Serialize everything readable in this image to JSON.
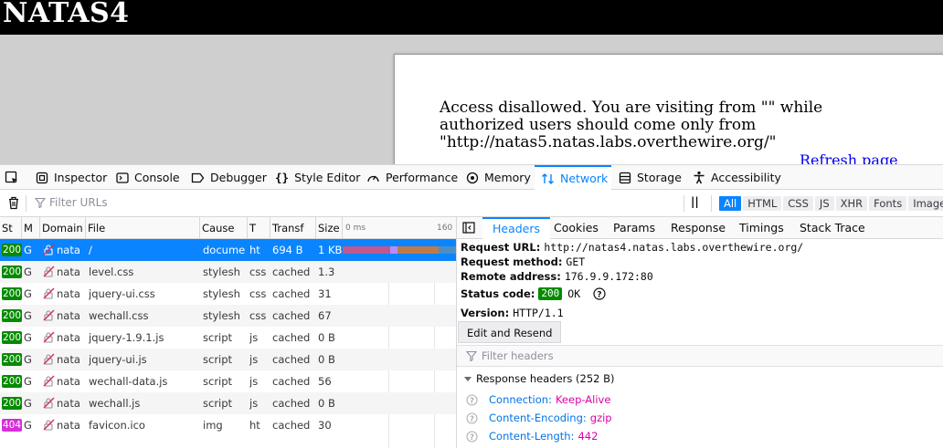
{
  "page": {
    "title": "NATAS4",
    "message": "Access disallowed. You are visiting from \"\" while authorized users should come only from \"http://natas5.natas.labs.overthewire.org/\"",
    "refresh_label": "Refresh page"
  },
  "devtools": {
    "tabs": [
      {
        "label": "Inspector",
        "icon": "inspector-icon"
      },
      {
        "label": "Console",
        "icon": "console-icon"
      },
      {
        "label": "Debugger",
        "icon": "debugger-icon"
      },
      {
        "label": "Style Editor",
        "icon": "style-editor-icon"
      },
      {
        "label": "Performance",
        "icon": "performance-icon"
      },
      {
        "label": "Memory",
        "icon": "memory-icon"
      },
      {
        "label": "Network",
        "icon": "network-icon",
        "active": true
      },
      {
        "label": "Storage",
        "icon": "storage-icon"
      },
      {
        "label": "Accessibility",
        "icon": "accessibility-icon"
      }
    ],
    "filter_placeholder": "Filter URLs",
    "pause_symbol": "||",
    "type_filters": [
      "All",
      "HTML",
      "CSS",
      "JS",
      "XHR",
      "Fonts",
      "Images"
    ],
    "active_type_filter": "All"
  },
  "requests": {
    "columns": [
      "St",
      "M",
      "Domain",
      "File",
      "Cause",
      "T",
      "Transf",
      "Size",
      "0 ms",
      "160"
    ],
    "rows": [
      {
        "status": "200",
        "method": "G",
        "domain": "nata",
        "file": "/",
        "cause": "docume",
        "type": "ht",
        "transferred": "694 B",
        "size": "1 KB",
        "selected": true
      },
      {
        "status": "200",
        "method": "G",
        "domain": "nata",
        "file": "level.css",
        "cause": "stylesh",
        "type": "css",
        "transferred": "cached",
        "size": "1.3"
      },
      {
        "status": "200",
        "method": "G",
        "domain": "nata",
        "file": "jquery-ui.css",
        "cause": "stylesh",
        "type": "css",
        "transferred": "cached",
        "size": "31"
      },
      {
        "status": "200",
        "method": "G",
        "domain": "nata",
        "file": "wechall.css",
        "cause": "stylesh",
        "type": "css",
        "transferred": "cached",
        "size": "67"
      },
      {
        "status": "200",
        "method": "G",
        "domain": "nata",
        "file": "jquery-1.9.1.js",
        "cause": "script",
        "type": "js",
        "transferred": "cached",
        "size": "0 B"
      },
      {
        "status": "200",
        "method": "G",
        "domain": "nata",
        "file": "jquery-ui.js",
        "cause": "script",
        "type": "js",
        "transferred": "cached",
        "size": "0 B"
      },
      {
        "status": "200",
        "method": "G",
        "domain": "nata",
        "file": "wechall-data.js",
        "cause": "script",
        "type": "js",
        "transferred": "cached",
        "size": "56"
      },
      {
        "status": "200",
        "method": "G",
        "domain": "nata",
        "file": "wechall.js",
        "cause": "script",
        "type": "js",
        "transferred": "cached",
        "size": "0 B"
      },
      {
        "status": "404",
        "method": "G",
        "domain": "nata",
        "file": "favicon.ico",
        "cause": "img",
        "type": "ht",
        "transferred": "cached",
        "size": "30"
      }
    ]
  },
  "details": {
    "tabs": [
      "Headers",
      "Cookies",
      "Params",
      "Response",
      "Timings",
      "Stack Trace"
    ],
    "active_tab": "Headers",
    "request_url_label": "Request URL:",
    "request_url": "http://natas4.natas.labs.overthewire.org/",
    "request_method_label": "Request method:",
    "request_method": "GET",
    "remote_address_label": "Remote address:",
    "remote_address": "176.9.9.172:80",
    "status_code_label": "Status code:",
    "status_code": "200",
    "status_text": "OK",
    "version_label": "Version:",
    "version": "HTTP/1.1",
    "edit_resend_label": "Edit and Resend",
    "filter_headers_placeholder": "Filter headers",
    "response_headers_title": "Response headers (252 B)",
    "response_headers": [
      {
        "name": "Connection:",
        "value": "Keep-Alive"
      },
      {
        "name": "Content-Encoding:",
        "value": "gzip"
      },
      {
        "name": "Content-Length:",
        "value": "442"
      }
    ]
  },
  "colors": {
    "accent": "#0a84ff",
    "status_ok": "#058b00",
    "status_404": "#d62fd9"
  }
}
